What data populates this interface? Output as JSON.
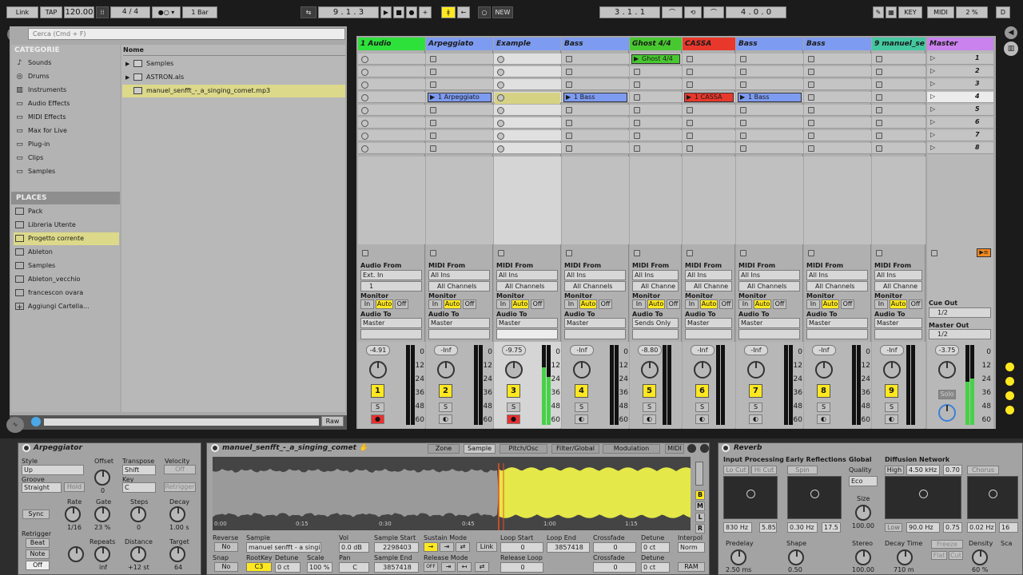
{
  "transport": {
    "link": "Link",
    "tap": "TAP",
    "tempo": "120.00",
    "sig_num": "4",
    "sig_den": "4",
    "quantize": "1 Bar",
    "position": "9 . 1 . 3",
    "new_label": "NEW",
    "loop_start": "3 . 1 . 1",
    "loop_length": "4 . 0 . 0",
    "key_label": "KEY",
    "midi_label": "MIDI",
    "cpu": "2 %",
    "d_label": "D"
  },
  "browser": {
    "search_placeholder": "Cerca (Cmd + F)",
    "categories_title": "CATEGORIE",
    "categories": [
      "Sounds",
      "Drums",
      "Instruments",
      "Audio Effects",
      "MIDI Effects",
      "Max for Live",
      "Plug-in",
      "Clips",
      "Samples"
    ],
    "places_title": "PLACES",
    "places": [
      "Pack",
      "Libreria Utente",
      "Progetto corrente",
      "Ableton",
      "Samples",
      "Ableton_vecchio",
      "francescon ovara",
      "Aggiungi Cartella..."
    ],
    "column_header": "Nome",
    "files": [
      "Samples",
      "ASTRON.als",
      "manuel_senfft_-_a_singing_comet.mp3"
    ],
    "raw_label": "Raw"
  },
  "tracks": [
    {
      "title": "1 Audio",
      "color": "#2ee03a",
      "from_label": "Audio From",
      "from": "Ext. In",
      "channel": "1",
      "to": "Master",
      "volume": "-4.91",
      "number": "1",
      "clip": ""
    },
    {
      "title": "Arpeggiato",
      "color": "#7d9bf0",
      "from_label": "MIDI From",
      "from": "All Ins",
      "channel": "All Channels",
      "to": "Master",
      "volume": "-Inf",
      "number": "2",
      "clip": "1 Arpeggiato"
    },
    {
      "title": "Example",
      "color": "#7d9bf0",
      "from_label": "MIDI From",
      "from": "All Ins",
      "channel": "All Channels",
      "to": "Master",
      "volume": "-9.75",
      "number": "3",
      "clip": ""
    },
    {
      "title": "Bass",
      "color": "#7d9bf0",
      "from_label": "MIDI From",
      "from": "All Ins",
      "channel": "All Channels",
      "to": "Master",
      "volume": "-Inf",
      "number": "4",
      "clip": "1 Bass"
    },
    {
      "title": "Ghost 4/4",
      "color": "#48c830",
      "from_label": "MIDI From",
      "from": "All Ins",
      "channel": "All Channe",
      "to": "Sends Only",
      "volume": "-8.80",
      "number": "5",
      "clip": "Ghost 4/4"
    },
    {
      "title": "CASSA",
      "color": "#e8382c",
      "from_label": "MIDI From",
      "from": "All Ins",
      "channel": "All Channe",
      "to": "Master",
      "volume": "-Inf",
      "number": "6",
      "clip": "1 CASSA"
    },
    {
      "title": "Bass",
      "color": "#7d9bf0",
      "from_label": "MIDI From",
      "from": "All Ins",
      "channel": "All Channels",
      "to": "Master",
      "volume": "-Inf",
      "number": "7",
      "clip": "1 Bass"
    },
    {
      "title": "Bass",
      "color": "#7d9bf0",
      "from_label": "MIDI From",
      "from": "All Ins",
      "channel": "All Channels",
      "to": "Master",
      "volume": "-Inf",
      "number": "8",
      "clip": ""
    },
    {
      "title": "9 manuel_se",
      "color": "#44c8a0",
      "from_label": "MIDI From",
      "from": "All Ins",
      "channel": "All Channe",
      "to": "Master",
      "volume": "-Inf",
      "number": "9",
      "clip": ""
    }
  ],
  "io_labels": {
    "monitor": "Monitor",
    "in": "In",
    "auto": "Auto",
    "off": "Off",
    "audio_to": "Audio To",
    "s": "S"
  },
  "master": {
    "title": "Master",
    "scenes": [
      "1",
      "2",
      "3",
      "4",
      "5",
      "6",
      "7",
      "8"
    ],
    "cue_out_label": "Cue Out",
    "cue_out": "1/2",
    "master_out_label": "Master Out",
    "master_out": "1/2",
    "volume": "-3.75",
    "solo": "Solo"
  },
  "meter_scale": [
    "0",
    "12",
    "24",
    "36",
    "48",
    "60"
  ],
  "arpeggiator": {
    "title": "Arpeggiator",
    "style_label": "Style",
    "style": "Up",
    "groove_label": "Groove",
    "groove": "Straight",
    "hold": "Hold",
    "offset_label": "Offset",
    "offset": "0",
    "transpose_label": "Transpose",
    "transpose": "Shift",
    "key_label": "Key",
    "key": "C",
    "velocity_label": "Velocity",
    "velocity": "Off",
    "retrigger_btn": "Retrigger",
    "sync": "Sync",
    "rate_label": "Rate",
    "rate": "1/16",
    "gate_label": "Gate",
    "gate": "23 %",
    "steps_label": "Steps",
    "steps": "0",
    "decay_label": "Decay",
    "decay": "1.00 s",
    "retrigger_label": "Retrigger",
    "beat": "Beat",
    "note": "Note",
    "off": "Off",
    "repeats_label": "Repeats",
    "repeats": "inf",
    "distance_label": "Distance",
    "distance": "+12 st",
    "target_label": "Target",
    "target": "64"
  },
  "sampler": {
    "title": "manuel_senfft_-_a_singing_comet",
    "tabs": [
      "Zone",
      "Sample",
      "Pitch/Osc",
      "Filter/Global",
      "Modulation",
      "MIDI"
    ],
    "times": [
      "0:00",
      "0:15",
      "0:30",
      "0:45",
      "1:00",
      "1:15"
    ],
    "side_btns": [
      "B",
      "M",
      "L",
      "R"
    ],
    "reverse_label": "Reverse",
    "reverse": "No",
    "snap_label": "Snap",
    "snap": "No",
    "sample_label": "Sample",
    "sample": "manuel senfft - a singi",
    "rootkey_label": "RootKey",
    "rootkey": "C3",
    "detune_label": "Detune",
    "detune": "0 ct",
    "vol_label": "Vol",
    "vol": "0.0 dB",
    "scale_label": "Scale",
    "scale": "100 %",
    "pan_label": "Pan",
    "pan": "C",
    "sample_start_label": "Sample Start",
    "sample_start": "2298403",
    "sample_end_label": "Sample End",
    "sample_end": "3857418",
    "sustain_mode_label": "Sustain Mode",
    "release_mode_label": "Release Mode",
    "release_off": "OFF",
    "link": "Link",
    "loop_start_label": "Loop Start",
    "loop_start": "0",
    "loop_end_label": "Loop End",
    "loop_end": "3857418",
    "release_loop_label": "Release Loop",
    "release_loop": "0",
    "crossfade_label": "Crossfade",
    "crossfade": "0",
    "crossfade2": "0",
    "detune2_label": "Detune",
    "detune2": "0 ct",
    "detune3": "0 ct",
    "interpol_label": "Interpol",
    "interpol": "Norm",
    "ram": "RAM"
  },
  "reverb": {
    "title": "Reverb",
    "input_label": "Input Processing",
    "lo_cut": "Lo Cut",
    "hi_cut": "Hi Cut",
    "early_label": "Early Reflections",
    "spin": "Spin",
    "global_label": "Global",
    "quality_label": "Quality",
    "quality": "Eco",
    "size_label": "Size",
    "size": "100.00",
    "diffusion_label": "Diffusion Network",
    "high": "High",
    "high_freq": "4.50 kHz",
    "high_val": "0.70",
    "chorus": "Chorus",
    "in_freq": "830 Hz",
    "in_q": "5.85",
    "er_freq": "0.30 Hz",
    "er_val": "17.5",
    "low": "Low",
    "low_freq": "90.0 Hz",
    "low_val": "0.75",
    "mod_freq": "0.02 Hz",
    "mod_val": "16",
    "predelay_label": "Predelay",
    "predelay": "2.50 ms",
    "shape_label": "Shape",
    "shape": "0.50",
    "stereo_label": "Stereo",
    "stereo": "100.00",
    "decay_label": "Decay Time",
    "decay": "710 m",
    "freeze": "Freeze",
    "flat": "Flat",
    "cut": "Cut",
    "density_label": "Density",
    "density": "60 %",
    "sca_label": "Sca"
  }
}
